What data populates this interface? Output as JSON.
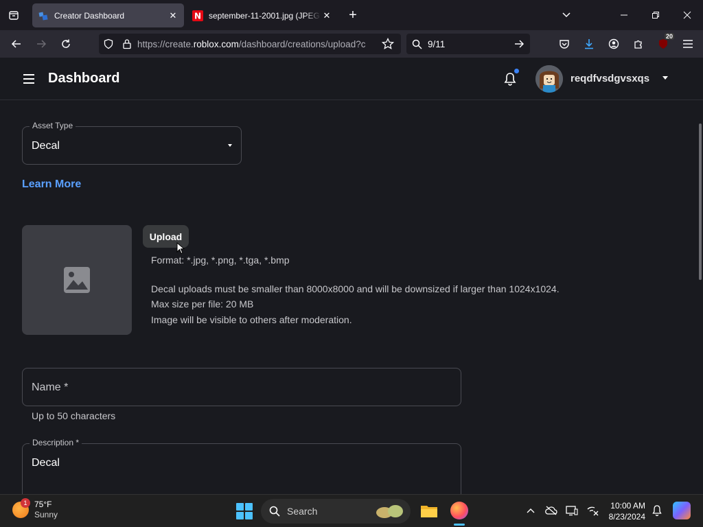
{
  "browser": {
    "tabs": [
      {
        "title": "Creator Dashboard",
        "active": true,
        "favicon": "roblox-favicon"
      },
      {
        "title": "september-11-2001.jpg (JPEG Im",
        "active": false,
        "favicon": "n-favicon"
      }
    ],
    "url_prefix": "https://create.",
    "url_domain": "roblox.com",
    "url_suffix": "/dashboard/creations/upload?c",
    "search_value": "9/11",
    "extension_badge": "20"
  },
  "header": {
    "title": "Dashboard",
    "username": "reqdfvsdgvsxqs"
  },
  "form": {
    "asset_type_label": "Asset Type",
    "asset_type_value": "Decal",
    "learn_more": "Learn More",
    "upload_label": "Upload",
    "format_text": "Format: *.jpg, *.png, *.tga, *.bmp",
    "size_text": "Decal uploads must be smaller than 8000x8000 and will be downsized if larger than 1024x1024.",
    "max_size_text": "Max size per file: 20 MB",
    "moderation_text": "Image will be visible to others after moderation.",
    "name_placeholder": "Name *",
    "name_helper": "Up to 50 characters",
    "description_label": "Description *",
    "description_value": "Decal"
  },
  "taskbar": {
    "weather_temp": "75°F",
    "weather_cond": "Sunny",
    "weather_badge": "1",
    "search_placeholder": "Search",
    "time": "10:00 AM",
    "date": "8/23/2024"
  },
  "colors": {
    "accent_link": "#5aa0ff",
    "notification_dot": "#3b82f6"
  }
}
